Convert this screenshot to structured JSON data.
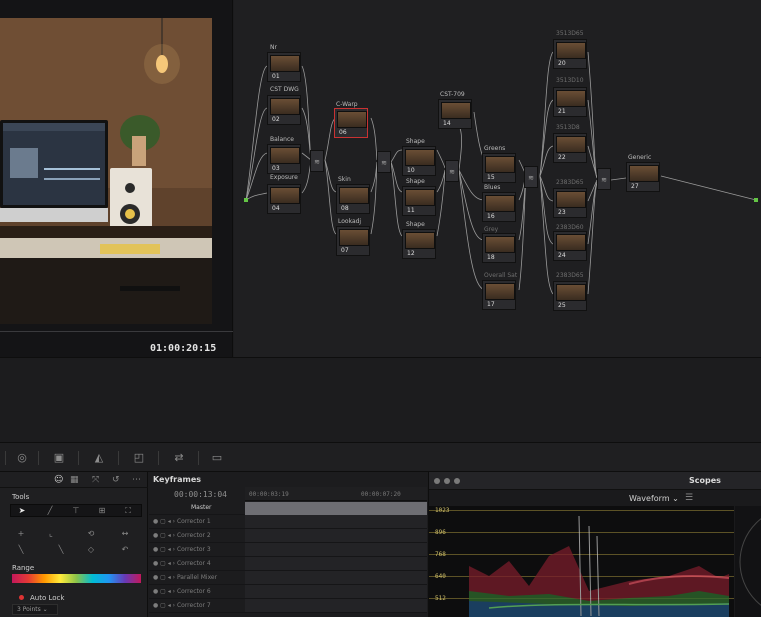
{
  "viewer": {
    "timecode": "01:00:20:15"
  },
  "nodes": {
    "n01": {
      "label": "Nr",
      "num": "01"
    },
    "n02": {
      "label": "CST DWG",
      "num": "02"
    },
    "n03": {
      "label": "Balance",
      "num": "03"
    },
    "n04": {
      "label": "Exposure",
      "num": "04"
    },
    "n06": {
      "label": "C-Warp",
      "num": "06"
    },
    "n08": {
      "label": "Skin",
      "num": "08"
    },
    "n07": {
      "label": "Lookadj",
      "num": "07"
    },
    "n10": {
      "label": "Shape",
      "num": "10"
    },
    "n11": {
      "label": "Shape",
      "num": "11"
    },
    "n12": {
      "label": "Shape",
      "num": "12"
    },
    "n14": {
      "label": "CST-709",
      "num": "14"
    },
    "n15": {
      "label": "Greens",
      "num": "15"
    },
    "n16": {
      "label": "Blues",
      "num": "16"
    },
    "n18": {
      "label": "Grey",
      "num": "18"
    },
    "n17": {
      "label": "Overall Sat",
      "num": "17"
    },
    "n20": {
      "label": "3513D65",
      "num": "20"
    },
    "n21": {
      "label": "3513D10",
      "num": "21"
    },
    "n22": {
      "label": "3513D8",
      "num": "22"
    },
    "n23": {
      "label": "2383D65",
      "num": "23"
    },
    "n24": {
      "label": "2383D60",
      "num": "24"
    },
    "n25": {
      "label": "2383D65",
      "num": "25"
    },
    "n27": {
      "label": "Generic",
      "num": "27"
    }
  },
  "tools": {
    "title": "Tools",
    "range_label": "Range",
    "auto_lock": "Auto Lock",
    "points": "3 Points"
  },
  "keyframes": {
    "title": "Keyframes",
    "timecode": "00:00:13:04",
    "ruler_ticks": [
      "00:00:03:19",
      "00:00:07:20"
    ],
    "rows": [
      "Master",
      "Corrector 1",
      "Corrector 2",
      "Corrector 3",
      "Corrector 4",
      "Parallel Mixer",
      "Corrector 6",
      "Corrector 7"
    ]
  },
  "scopes": {
    "title": "Scopes",
    "mode": "Waveform",
    "scale": [
      "1023",
      "896",
      "768",
      "640",
      "512"
    ]
  }
}
